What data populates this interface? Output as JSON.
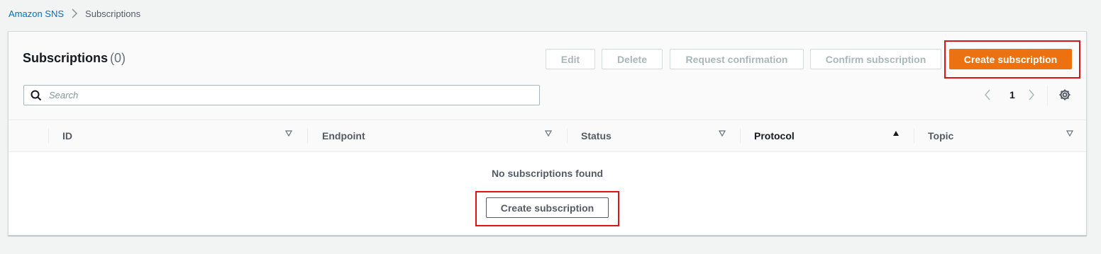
{
  "breadcrumb": {
    "root": "Amazon SNS",
    "current": "Subscriptions"
  },
  "header": {
    "title": "Subscriptions",
    "count": "(0)"
  },
  "actions": {
    "edit": "Edit",
    "delete": "Delete",
    "request_confirmation": "Request confirmation",
    "confirm_subscription": "Confirm subscription",
    "create_subscription": "Create subscription"
  },
  "search": {
    "placeholder": "Search",
    "value": ""
  },
  "pagination": {
    "current_page": "1"
  },
  "table": {
    "columns": [
      {
        "label": "ID",
        "sort": "none"
      },
      {
        "label": "Endpoint",
        "sort": "none"
      },
      {
        "label": "Status",
        "sort": "none"
      },
      {
        "label": "Protocol",
        "sort": "ascending"
      },
      {
        "label": "Topic",
        "sort": "none"
      }
    ],
    "empty_text": "No subscriptions found",
    "empty_action": "Create subscription"
  },
  "colors": {
    "primary": "#ec7211",
    "link": "#0073bb",
    "highlight": "#d91515"
  }
}
